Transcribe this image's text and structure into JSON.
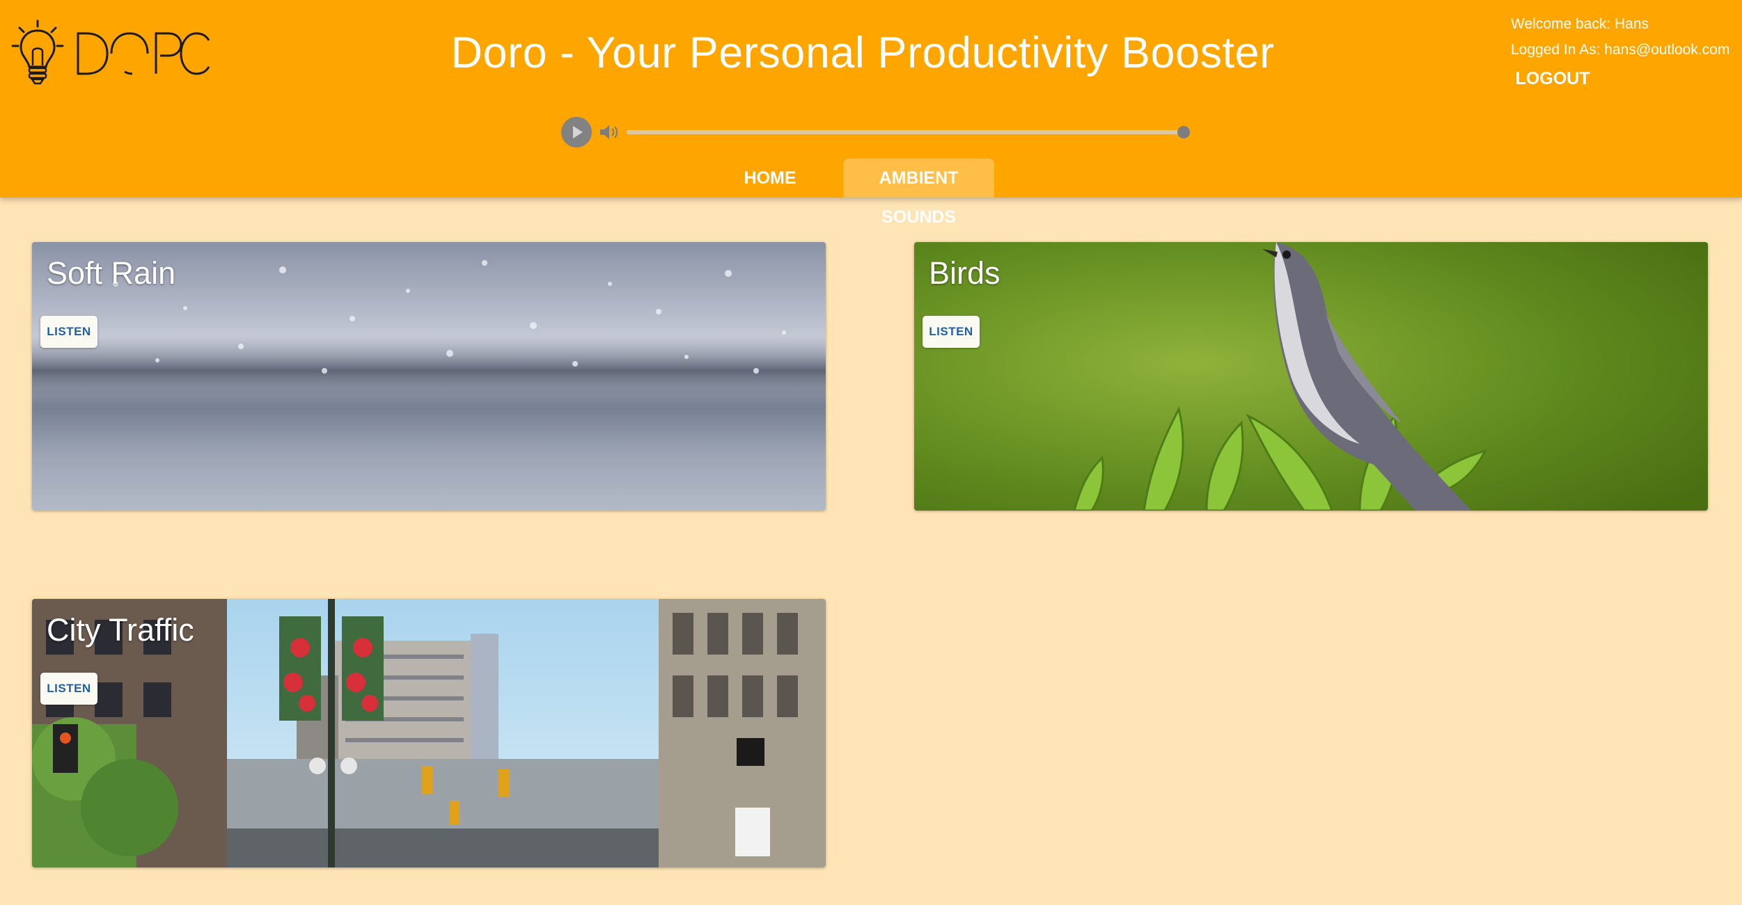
{
  "header": {
    "app_title": "Doro - Your Personal Productivity Booster",
    "logo_wordmark": "DORO",
    "welcome_text": "Welcome back: Hans",
    "logged_in_text": "Logged In As: hans@outlook.com",
    "logout_label": "LOGOUT"
  },
  "player": {
    "play_icon": "play-icon",
    "volume_icon": "volume-icon",
    "progress_fraction": 1.0
  },
  "nav": {
    "tabs": [
      {
        "label": "HOME",
        "active": false
      },
      {
        "label": "AMBIENT SOUNDS",
        "active": true
      }
    ]
  },
  "sounds": [
    {
      "title": "Soft Rain",
      "button_label": "LISTEN",
      "image": "rain droplets splashing on ground"
    },
    {
      "title": "Birds",
      "button_label": "LISTEN",
      "image": "grey bird perched on green leaves"
    },
    {
      "title": "City Traffic",
      "button_label": "LISTEN",
      "image": "city street with buildings and traffic lights"
    }
  ],
  "colors": {
    "header_bg": "#ffa500",
    "page_bg": "#ffe4b5",
    "button_text": "#1f5fa8"
  }
}
